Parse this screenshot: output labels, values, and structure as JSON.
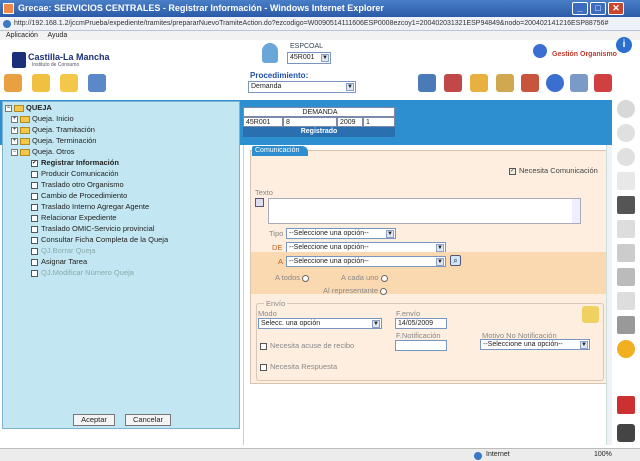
{
  "window": {
    "title": "Grecae: SERVICIOS CENTRALES - Registrar Información - Windows Internet Explorer",
    "url": "http://192.168.1.2/jccmPrueba/expediente/tramites/prepararNuevoTramiteAction.do?ezcodigo=W0090514111606ESP0008ezcoy1=200402031321ESP94849&nodo=200402141216ESP88756#"
  },
  "menu": [
    "Aplicación",
    "Ayuda"
  ],
  "header": {
    "logo": "Castilla-La Mancha",
    "logo_sub": "Instituto de Consumo",
    "user_label": "ESPCOAL",
    "user_value": "45R001",
    "right_label": "Gestión Organismo",
    "procedimiento_label": "Procedimiento:",
    "procedimiento_value": "Demanda"
  },
  "demanda": {
    "header": "DEMANDA",
    "cells": [
      "45R001",
      "8",
      "2009",
      "1"
    ],
    "status": "Registrado"
  },
  "tree": {
    "root": "QUEJA",
    "nodes": [
      {
        "label": "Queja. Inicio",
        "type": "folder"
      },
      {
        "label": "Queja. Tramitación",
        "type": "folder"
      },
      {
        "label": "Queja. Terminación",
        "type": "folder"
      },
      {
        "label": "Queja. Otros",
        "type": "folder"
      }
    ],
    "leaves": [
      {
        "label": "Registrar Información",
        "checked": true,
        "bold": true,
        "disabled": false
      },
      {
        "label": "Producir Comunicación",
        "checked": false,
        "bold": false,
        "disabled": false
      },
      {
        "label": "Traslado otro Organismo",
        "checked": false,
        "bold": false,
        "disabled": false
      },
      {
        "label": "Cambio de Procedimiento",
        "checked": false,
        "bold": false,
        "disabled": false
      },
      {
        "label": "Traslado Interno Agregar Agente",
        "checked": false,
        "bold": false,
        "disabled": false
      },
      {
        "label": "Relacionar Expediente",
        "checked": false,
        "bold": false,
        "disabled": false
      },
      {
        "label": "Traslado OMIC-Servicio provincial",
        "checked": false,
        "bold": false,
        "disabled": false
      },
      {
        "label": "Consultar Ficha Completa de la Queja",
        "checked": false,
        "bold": false,
        "disabled": false
      },
      {
        "label": "QJ.Borrar Queja",
        "checked": false,
        "bold": false,
        "disabled": true
      },
      {
        "label": "Asignar Tarea",
        "checked": false,
        "bold": false,
        "disabled": false
      },
      {
        "label": "QJ.Modificar Número Queja",
        "checked": false,
        "bold": false,
        "disabled": true
      }
    ],
    "accept": "Aceptar",
    "cancel": "Cancelar"
  },
  "form": {
    "tab": "Comunicación",
    "necesita_comunicacion": "Necesita Comunicación",
    "texto": "Texto",
    "tipo": "Tipo",
    "tipo_value": "--Seleccione una opción--",
    "de": "DE",
    "de_value": "--Seleccione una opción--",
    "a": "A",
    "a_value": "--Seleccione una opción--",
    "a_todos": "A todos",
    "a_cada_uno": "A cada uno",
    "al_representante": "Al representante",
    "envio": "Envío",
    "modo": "Modo",
    "modo_value": "Selecc. una opción",
    "fenvio": "F.envío",
    "fenvio_value": "14/05/2009",
    "fnotificacion": "F.Notificación",
    "motivo": "Motivo No Notificación",
    "motivo_value": "--Seleccione una opción--",
    "acuse": "Necesita acuse de recibo",
    "respuesta": "Necesita Respuesta"
  },
  "status": {
    "zone": "Internet",
    "zoom": "100%"
  },
  "colors": {
    "accent_blue": "#2d8ed0",
    "tree_bg": "#c3e7f2",
    "form_bg": "#fdeee0",
    "highlight_band": "#fbd9b0"
  }
}
